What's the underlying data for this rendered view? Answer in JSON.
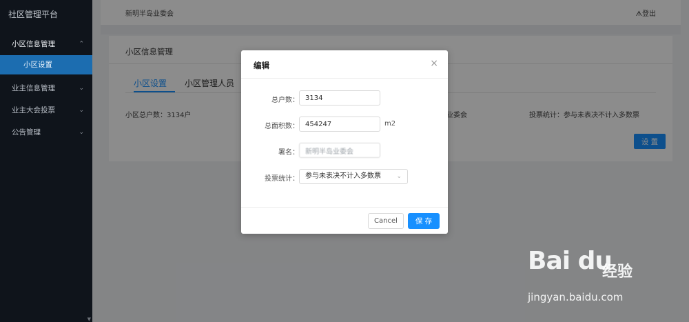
{
  "sidebar": {
    "brand": "社区管理平台",
    "items": [
      {
        "label": "小区信息管理",
        "chevron": "⌃"
      },
      {
        "label": "业主信息管理",
        "chevron": "⌄"
      },
      {
        "label": "业主大会投票",
        "chevron": "⌄"
      },
      {
        "label": "公告管理",
        "chevron": "⌄"
      }
    ],
    "sub_item": "小区设置"
  },
  "topbar": {
    "org_name": "新明半岛业委会",
    "logout": "ᗑ登出"
  },
  "page": {
    "card_title": "小区信息管理",
    "tabs": [
      "小区设置",
      "小区管理人员"
    ],
    "stat_households": "小区总户数：3134户",
    "stat_org": "业委会",
    "stat_vote": "投票统计：参与未表决不计入多数票",
    "set_button": "设 置"
  },
  "modal": {
    "title": "编辑",
    "close_icon": "×",
    "fields": [
      {
        "label": "总户数：",
        "value": "3134"
      },
      {
        "label": "总面积数：",
        "value": "454247",
        "unit": "m2"
      },
      {
        "label": "署名：",
        "value": "新明半岛业委会"
      }
    ],
    "vote_label": "投票统计：",
    "vote_value": "参与未表决不计入多数票",
    "cancel": "Cancel",
    "save": "保 存"
  },
  "watermark": {
    "logo": "Bai du",
    "jingyan": "经验",
    "url": "jingyan.baidu.com"
  }
}
